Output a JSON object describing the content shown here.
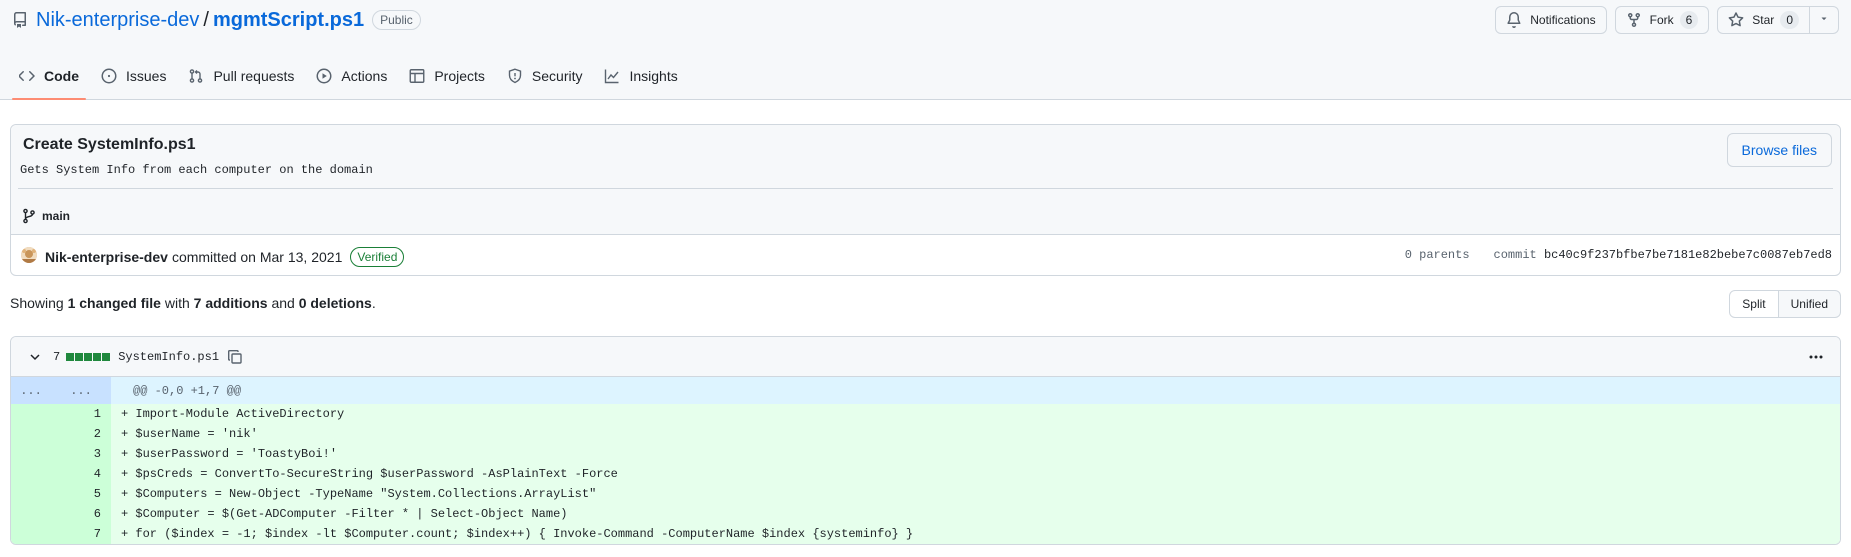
{
  "repo": {
    "owner": "Nik-enterprise-dev",
    "separator": "/",
    "name": "mgmtScript.ps1",
    "visibility": "Public"
  },
  "actions": {
    "notifications": "Notifications",
    "fork_label": "Fork",
    "fork_count": "6",
    "star_label": "Star",
    "star_count": "0"
  },
  "tabs": [
    {
      "label": "Code",
      "icon": "code-icon"
    },
    {
      "label": "Issues",
      "icon": "issue-opened-icon"
    },
    {
      "label": "Pull requests",
      "icon": "git-pull-request-icon"
    },
    {
      "label": "Actions",
      "icon": "play-icon"
    },
    {
      "label": "Projects",
      "icon": "table-icon"
    },
    {
      "label": "Security",
      "icon": "shield-icon"
    },
    {
      "label": "Insights",
      "icon": "graph-icon"
    }
  ],
  "commit": {
    "title": "Create SystemInfo.ps1",
    "description": "Gets System Info from each computer on the domain",
    "browse_label": "Browse files",
    "branch": "main",
    "author": "Nik-enterprise-dev",
    "meta": "committed on Mar 13, 2021",
    "verified": "Verified",
    "parents": "0 parents",
    "commit_label": "commit",
    "sha": "bc40c9f237bfbe7be7181e82bebe7c0087eb7ed8"
  },
  "summary": {
    "prefix": "Showing",
    "changed": "1 changed file",
    "with": "with",
    "additions": "7 additions",
    "and": "and",
    "deletions": "0 deletions",
    "suffix": "."
  },
  "view": {
    "split": "Split",
    "unified": "Unified"
  },
  "file": {
    "change_count": "7",
    "name": "SystemInfo.ps1",
    "hunk_left": "...",
    "hunk_right": "...",
    "hunk_header": "@@ -0,0 +1,7 @@"
  },
  "lines": [
    {
      "num": "1",
      "text": "+ Import-Module ActiveDirectory"
    },
    {
      "num": "2",
      "text": "+ $userName = 'nik'"
    },
    {
      "num": "3",
      "text": "+ $userPassword = 'ToastyBoi!'"
    },
    {
      "num": "4",
      "text": "+ $psCreds = ConvertTo-SecureString $userPassword -AsPlainText -Force"
    },
    {
      "num": "5",
      "text": "+ $Computers = New-Object -TypeName \"System.Collections.ArrayList\""
    },
    {
      "num": "6",
      "text": "+ $Computer = $(Get-ADComputer -Filter * | Select-Object Name)"
    },
    {
      "num": "7",
      "text": "+ for ($index = -1; $index -lt $Computer.count; $index++) { Invoke-Command -ComputerName $index {systeminfo} }"
    }
  ],
  "colors": {
    "link": "#0969da",
    "active_tab_underline": "#fd8c73",
    "addition_bg": "#e6ffec",
    "addition_num_bg": "#ccffd8",
    "hunk_bg": "#ddf4ff",
    "verified": "#1a7f37"
  }
}
